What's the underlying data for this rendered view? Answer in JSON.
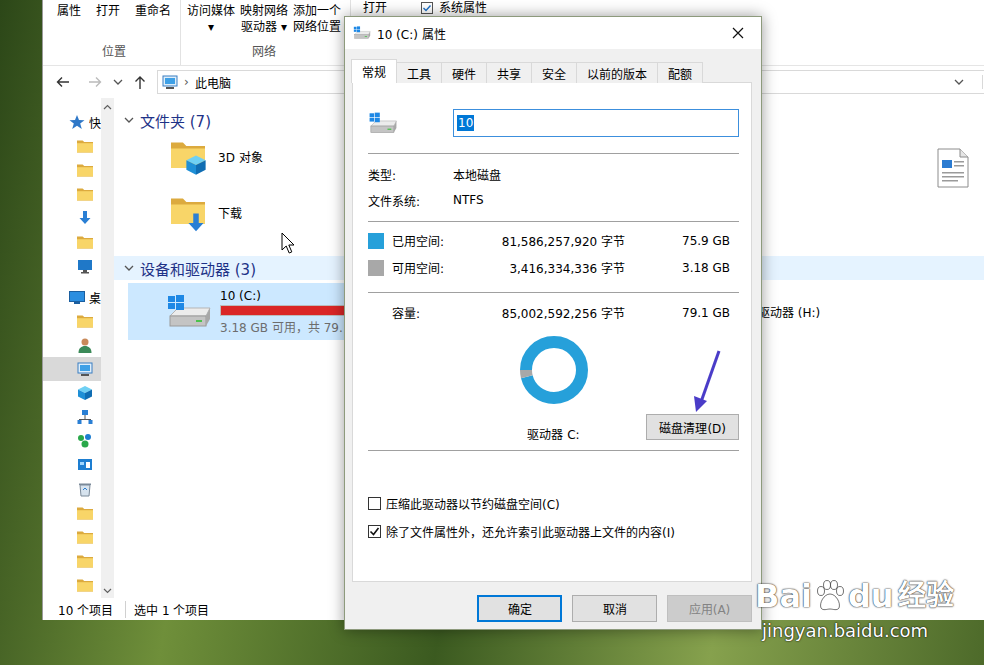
{
  "explorer": {
    "ribbon": {
      "groups": [
        {
          "label": "位置",
          "buttons": [
            {
              "lines": [
                "属性"
              ]
            },
            {
              "lines": [
                "打开"
              ]
            },
            {
              "lines": [
                "重命名"
              ]
            }
          ]
        },
        {
          "label": "网络",
          "buttons": [
            {
              "lines": [
                "访问媒体",
                "▾"
              ]
            },
            {
              "lines": [
                "映射网络",
                "驱动器 ▾"
              ]
            },
            {
              "lines": [
                "添加一个",
                "网络位置"
              ]
            }
          ]
        },
        {
          "buttons": [
            {
              "lines": [
                "打开"
              ]
            },
            {
              "lines": [
                "系统属性"
              ]
            }
          ]
        }
      ]
    },
    "address": {
      "separator": "›",
      "path": "此电脑"
    },
    "nav": {
      "items": [
        {
          "kind": "star",
          "label": "快",
          "depth": 0,
          "selected": false
        },
        {
          "kind": "folder",
          "depth": 1,
          "selected": false
        },
        {
          "kind": "folder",
          "depth": 1,
          "selected": false
        },
        {
          "kind": "folder",
          "depth": 1,
          "selected": false
        },
        {
          "kind": "download",
          "depth": 1,
          "selected": false
        },
        {
          "kind": "folder",
          "depth": 1,
          "selected": false
        },
        {
          "kind": "monitor",
          "depth": 1,
          "selected": false
        },
        {
          "kind": "desktop",
          "label": "桌",
          "depth": 0,
          "selected": false
        },
        {
          "kind": "folder",
          "depth": 1,
          "selected": false
        },
        {
          "kind": "user",
          "depth": 1,
          "selected": false
        },
        {
          "kind": "pc",
          "depth": 1,
          "selected": true
        },
        {
          "kind": "cube",
          "depth": 1,
          "selected": false
        },
        {
          "kind": "network",
          "depth": 1,
          "selected": false
        },
        {
          "kind": "homegroup",
          "depth": 1,
          "selected": false
        },
        {
          "kind": "control",
          "depth": 1,
          "selected": false
        },
        {
          "kind": "recycle",
          "depth": 1,
          "selected": false
        },
        {
          "kind": "folder",
          "depth": 1,
          "selected": false
        },
        {
          "kind": "folder",
          "depth": 1,
          "selected": false
        },
        {
          "kind": "folder",
          "depth": 1,
          "selected": false
        },
        {
          "kind": "folder",
          "depth": 1,
          "selected": false
        }
      ]
    },
    "folders": {
      "title": "文件夹 (7)",
      "expanded": true,
      "items": [
        {
          "name": "3D 对象",
          "kind": "cube"
        },
        {
          "kind": "document"
        },
        {
          "name": "下载",
          "kind": "download"
        }
      ]
    },
    "devices": {
      "title": "设备和驱动器 (3)",
      "expanded": true,
      "hover": true,
      "drives": [
        {
          "name": "10 (C:)",
          "detail": "3.18 GB 可用，共 79.",
          "level": 0.96,
          "low": true,
          "selected": true
        },
        {
          "name": "驱动器 (H:)",
          "selected": false
        }
      ]
    },
    "status": {
      "count": "10 个项目",
      "selection": "选中 1 个项目"
    }
  },
  "dialog": {
    "title": "10 (C:) 属性",
    "tabs": [
      {
        "label": "常规",
        "selected": true
      },
      {
        "label": "工具",
        "selected": false
      },
      {
        "label": "硬件",
        "selected": false
      },
      {
        "label": "共享",
        "selected": false
      },
      {
        "label": "安全",
        "selected": false
      },
      {
        "label": "以前的版本",
        "selected": false
      },
      {
        "label": "配额",
        "selected": false
      }
    ],
    "name_field": {
      "value": "10",
      "selected": true
    },
    "info": [
      {
        "label": "类型:",
        "value": "本地磁盘"
      },
      {
        "label": "文件系统:",
        "value": "NTFS"
      }
    ],
    "space": [
      {
        "label": "已用空间:",
        "bytes": "81,586,257,920 字节",
        "size": "75.9 GB",
        "color": "#26a0da"
      },
      {
        "label": "可用空间:",
        "bytes": "3,416,334,336 字节",
        "size": "3.18 GB",
        "color": "#a8a8a8"
      }
    ],
    "capacity": {
      "label": "容量:",
      "bytes": "85,002,592,256 字节",
      "size": "79.1 GB"
    },
    "chart": {
      "values": [
        75.9,
        3.18
      ]
    },
    "drive_label": "驱动器 C:",
    "cleanup_button": "磁盘清理(D)",
    "options": [
      {
        "label": "压缩此驱动器以节约磁盘空间(C)",
        "checked": false
      },
      {
        "label": "除了文件属性外，还允许索引此驱动器上文件的内容(I)",
        "checked": true
      }
    ],
    "buttons": [
      {
        "label": "确定",
        "default": true,
        "disabled": false
      },
      {
        "label": "取消",
        "default": false,
        "disabled": false
      },
      {
        "label": "应用(A)",
        "default": false,
        "disabled": true
      }
    ]
  },
  "watermark": {
    "brand_left": "Bai",
    "brand_right": "du",
    "brand_cn": "经验",
    "url": "jingyan.baidu.com"
  }
}
